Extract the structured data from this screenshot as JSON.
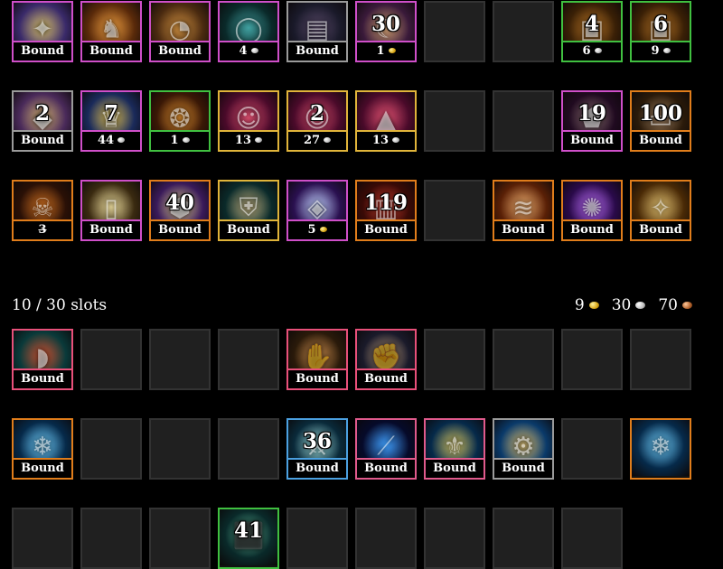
{
  "colors": {
    "pink": "#cf4fc9",
    "green": "#40c040",
    "orange": "#e07d1b",
    "gray": "#9a9a9a",
    "yellow": "#e0b43a",
    "salmon": "#e8507a",
    "blue": "#4ba0e0",
    "rose": "#e05a8c",
    "empty_bg": "#202020",
    "empty_border": "#333333"
  },
  "inventory_top": [
    {
      "empty": false,
      "border": "pink",
      "icon": "golden-emblem-icon",
      "tone": [
        "#3a2a6a",
        "#d7c06a"
      ],
      "stack": "",
      "caption": "Bound",
      "coin": ""
    },
    {
      "empty": false,
      "border": "pink",
      "icon": "golden-dragon-icon",
      "tone": [
        "#5a2a0a",
        "#f0a040"
      ],
      "stack": "",
      "caption": "Bound",
      "coin": ""
    },
    {
      "empty": false,
      "border": "pink",
      "icon": "pocket-watch-icon",
      "tone": [
        "#4a2a10",
        "#d09040"
      ],
      "stack": "",
      "caption": "Bound",
      "coin": ""
    },
    {
      "empty": false,
      "border": "pink",
      "icon": "jade-ring-icon",
      "tone": [
        "#0a2a2a",
        "#40a0a0"
      ],
      "stack": "",
      "caption": "4",
      "coin": "silver"
    },
    {
      "empty": false,
      "border": "gray",
      "icon": "dark-book-icon",
      "tone": [
        "#1a1a2a",
        "#5a4a6a"
      ],
      "stack": "",
      "caption": "Bound",
      "coin": ""
    },
    {
      "empty": false,
      "border": "pink",
      "icon": "crescent-moon-icon",
      "tone": [
        "#3a1a3a",
        "#d0a070"
      ],
      "stack": "30",
      "caption": "1",
      "coin": "gold"
    },
    {
      "empty": true
    },
    {
      "empty": true
    },
    {
      "empty": false,
      "border": "green",
      "icon": "bronze-tablet-icon",
      "tone": [
        "#3a2006",
        "#c07a28"
      ],
      "stack": "4",
      "caption": "6",
      "coin": "silver"
    },
    {
      "empty": false,
      "border": "green",
      "icon": "bronze-tablet-icon",
      "tone": [
        "#3a2006",
        "#c07a28"
      ],
      "stack": "6",
      "caption": "9",
      "coin": "silver"
    },
    {
      "empty": false,
      "border": "gray",
      "icon": "crystal-shard-icon",
      "tone": [
        "#4a2a5a",
        "#d0b070"
      ],
      "stack": "2",
      "caption": "Bound",
      "coin": ""
    },
    {
      "empty": false,
      "border": "pink",
      "icon": "golden-crown-icon",
      "tone": [
        "#1a2a5a",
        "#e0c050"
      ],
      "stack": "7",
      "caption": "44",
      "coin": "silver"
    },
    {
      "empty": false,
      "border": "green",
      "icon": "spiral-rune-icon",
      "tone": [
        "#3a1806",
        "#e09030"
      ],
      "stack": "",
      "caption": "1",
      "coin": "silver"
    },
    {
      "empty": false,
      "border": "yellow",
      "icon": "face-seal-icon",
      "tone": [
        "#4a0a2a",
        "#e05070"
      ],
      "stack": "",
      "caption": "13",
      "coin": "silver"
    },
    {
      "empty": false,
      "border": "yellow",
      "icon": "face-seal-icon",
      "tone": [
        "#4a0a2a",
        "#e05070"
      ],
      "stack": "2",
      "caption": "27",
      "coin": "silver"
    },
    {
      "empty": false,
      "border": "yellow",
      "icon": "wizard-hat-icon",
      "tone": [
        "#4a0a2a",
        "#e05070"
      ],
      "stack": "",
      "caption": "13",
      "coin": "silver"
    },
    {
      "empty": true
    },
    {
      "empty": true
    },
    {
      "empty": false,
      "border": "pink",
      "icon": "dark-relic-icon",
      "tone": [
        "#200a20",
        "#8a7070"
      ],
      "stack": "19",
      "caption": "Bound",
      "coin": ""
    },
    {
      "empty": false,
      "border": "orange",
      "icon": "treasure-chest-icon",
      "tone": [
        "#2a1a0a",
        "#a08060"
      ],
      "stack": "100",
      "caption": "Bound",
      "coin": ""
    },
    {
      "empty": false,
      "border": "orange",
      "icon": "dragon-skull-icon",
      "tone": [
        "#2a1006",
        "#d07020"
      ],
      "stack": "",
      "caption": "3",
      "coin": "",
      "strike": true
    },
    {
      "empty": false,
      "border": "pink",
      "icon": "white-tome-icon",
      "tone": [
        "#3a2a10",
        "#f0e0a0"
      ],
      "stack": "",
      "caption": "Bound",
      "coin": ""
    },
    {
      "empty": false,
      "border": "orange",
      "icon": "ore-chunk-icon",
      "tone": [
        "#3a1a5a",
        "#e0d090"
      ],
      "stack": "40",
      "caption": "Bound",
      "coin": ""
    },
    {
      "empty": false,
      "border": "yellow",
      "icon": "armor-plate-icon",
      "tone": [
        "#0a2a2a",
        "#c0b080"
      ],
      "stack": "",
      "caption": "Bound",
      "coin": ""
    },
    {
      "empty": false,
      "border": "pink",
      "icon": "prism-gem-icon",
      "tone": [
        "#2a1050",
        "#c0d0ff"
      ],
      "stack": "",
      "caption": "5",
      "coin": "gold"
    },
    {
      "empty": false,
      "border": "orange",
      "icon": "red-book-icon",
      "tone": [
        "#3a0a06",
        "#d04030"
      ],
      "stack": "119",
      "caption": "Bound",
      "coin": ""
    },
    {
      "empty": true
    },
    {
      "empty": false,
      "border": "orange",
      "icon": "scroll-icon",
      "tone": [
        "#5a2006",
        "#f0b070"
      ],
      "stack": "",
      "caption": "Bound",
      "coin": ""
    },
    {
      "empty": false,
      "border": "orange",
      "icon": "purple-burst-icon",
      "tone": [
        "#2a0a4a",
        "#c070ff"
      ],
      "stack": "",
      "caption": "Bound",
      "coin": ""
    },
    {
      "empty": false,
      "border": "orange",
      "icon": "map-scroll-icon",
      "tone": [
        "#4a2a06",
        "#e0c070"
      ],
      "stack": "",
      "caption": "Bound",
      "coin": ""
    }
  ],
  "slots": {
    "label": "10 / 30 slots"
  },
  "wallet": {
    "gold": "9",
    "silver": "30",
    "copper": "70"
  },
  "inventory_bottom": [
    {
      "empty": false,
      "border": "salmon",
      "icon": "shoulder-armor-icon",
      "tone": [
        "#0a3a3a",
        "#d05030"
      ],
      "stack": "",
      "caption": "Bound",
      "coin": ""
    },
    {
      "empty": true
    },
    {
      "empty": true
    },
    {
      "empty": true
    },
    {
      "empty": false,
      "border": "salmon",
      "icon": "ornate-gauntlet-icon",
      "tone": [
        "#2a1a0a",
        "#d09050"
      ],
      "stack": "",
      "caption": "Bound",
      "coin": ""
    },
    {
      "empty": false,
      "border": "salmon",
      "icon": "steel-gauntlet-icon",
      "tone": [
        "#1a1a2a",
        "#c0a080"
      ],
      "stack": "",
      "caption": "Bound",
      "coin": ""
    },
    {
      "empty": true
    },
    {
      "empty": true
    },
    {
      "empty": true
    },
    {
      "empty": true
    },
    {
      "empty": false,
      "border": "orange",
      "icon": "ice-crystal-icon",
      "tone": [
        "#062a4a",
        "#70d0ff"
      ],
      "stack": "",
      "caption": "Bound",
      "coin": ""
    },
    {
      "empty": true
    },
    {
      "empty": true
    },
    {
      "empty": true
    },
    {
      "empty": false,
      "border": "blue",
      "icon": "sword-icon",
      "tone": [
        "#0a2a3a",
        "#a0e0e0"
      ],
      "stack": "36",
      "caption": "Bound",
      "coin": ""
    },
    {
      "empty": false,
      "border": "rose",
      "icon": "blade-icon",
      "tone": [
        "#060a2a",
        "#40a0ff"
      ],
      "stack": "",
      "caption": "Bound",
      "coin": ""
    },
    {
      "empty": false,
      "border": "rose",
      "icon": "griffon-armor-icon",
      "tone": [
        "#062a4a",
        "#d0c060"
      ],
      "stack": "",
      "caption": "Bound",
      "coin": ""
    },
    {
      "empty": false,
      "border": "gray",
      "icon": "golden-machine-icon",
      "tone": [
        "#0a3a6a",
        "#e0c070"
      ],
      "stack": "",
      "caption": "Bound",
      "coin": ""
    },
    {
      "empty": true
    },
    {
      "empty": false,
      "border": "orange",
      "icon": "ice-crystal-icon",
      "tone": [
        "#062a4a",
        "#70d0ff"
      ],
      "stack": "",
      "caption": "",
      "coin": ""
    },
    {
      "empty": true
    },
    {
      "empty": true
    },
    {
      "empty": true
    },
    {
      "empty": false,
      "border": "green",
      "icon": "jade-cube-icon",
      "tone": [
        "#0a2a2a",
        "#60c0a0"
      ],
      "stack": "41",
      "caption": "",
      "coin": ""
    },
    {
      "empty": true
    },
    {
      "empty": true
    },
    {
      "empty": true
    },
    {
      "empty": true
    },
    {
      "empty": true
    }
  ]
}
